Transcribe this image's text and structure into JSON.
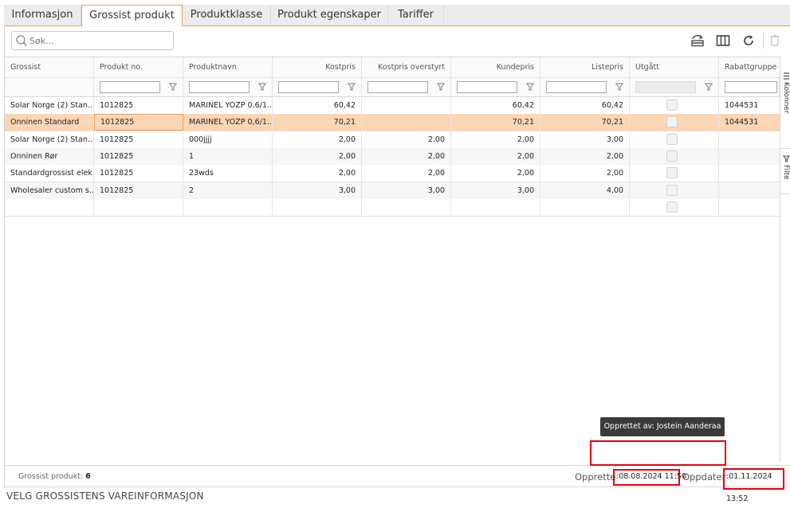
{
  "tabs": [
    {
      "label": "Informasjon",
      "active": false
    },
    {
      "label": "Grossist produkt",
      "active": true
    },
    {
      "label": "Produktklasse",
      "active": false
    },
    {
      "label": "Produkt egenskaper",
      "active": false
    },
    {
      "label": "Tariffer",
      "active": false
    }
  ],
  "search": {
    "placeholder": "Søk..."
  },
  "toolbar": {
    "icons": [
      "wholesaler-fetch-icon",
      "columns-icon",
      "refresh-icon",
      "delete-icon"
    ]
  },
  "grid": {
    "columns": [
      {
        "label": "Grossist"
      },
      {
        "label": "Produkt no."
      },
      {
        "label": "Produktnavn"
      },
      {
        "label": "Kostpris"
      },
      {
        "label": "Kostpris overstyrt"
      },
      {
        "label": "Kundepris"
      },
      {
        "label": "Listepris"
      },
      {
        "label": "Utgått"
      },
      {
        "label": "Rabattgruppe"
      }
    ],
    "rows": [
      {
        "grossist": "Solar Norge (2) Stan...",
        "produkt_no": "1012825",
        "produktnavn": "MARINEL YOZP 0,6/1...",
        "kostpris": "60,42",
        "kostpris_overstyrt": "",
        "kundepris": "60,42",
        "listepris": "60,42",
        "rabattgruppe": "1044531"
      },
      {
        "grossist": "Onninen Standard",
        "produkt_no": "1012825",
        "produktnavn": "MARINEL YOZP 0,6/1...",
        "kostpris": "70,21",
        "kostpris_overstyrt": "",
        "kundepris": "70,21",
        "listepris": "70,21",
        "rabattgruppe": "1044531"
      },
      {
        "grossist": "Solar Norge (2) Stan...",
        "produkt_no": "1012825",
        "produktnavn": "000jjjj",
        "kostpris": "2,00",
        "kostpris_overstyrt": "2,00",
        "kundepris": "2,00",
        "listepris": "3,00",
        "rabattgruppe": ""
      },
      {
        "grossist": "Onninen Rør",
        "produkt_no": "1012825",
        "produktnavn": "1",
        "kostpris": "2,00",
        "kostpris_overstyrt": "2,00",
        "kundepris": "2,00",
        "listepris": "2,00",
        "rabattgruppe": ""
      },
      {
        "grossist": "Standardgrossist elek...",
        "produkt_no": "1012825",
        "produktnavn": "23wds",
        "kostpris": "2,00",
        "kostpris_overstyrt": "2,00",
        "kundepris": "2,00",
        "listepris": "2,00",
        "rabattgruppe": ""
      },
      {
        "grossist": "Wholesaler custom s...",
        "produkt_no": "1012825",
        "produktnavn": "2",
        "kostpris": "3,00",
        "kostpris_overstyrt": "3,00",
        "kundepris": "3,00",
        "listepris": "4,00",
        "rabattgruppe": ""
      },
      {
        "grossist": "",
        "produkt_no": "",
        "produktnavn": "",
        "kostpris": "",
        "kostpris_overstyrt": "",
        "kundepris": "",
        "listepris": "",
        "rabattgruppe": ""
      }
    ]
  },
  "side_panel": {
    "columns_label": "Kolonner",
    "filter_label": "Filte"
  },
  "tooltip": {
    "text": "Opprettet av: Jostein Aanderaa"
  },
  "status": {
    "count_label": "Grossist produkt:",
    "count_value": "6",
    "created_label": "Opprette",
    "created_value": ":08.08.2024 11:50",
    "updated_label": "Oppdater",
    "updated_value": ":01.11.2024 13:52"
  },
  "footer": {
    "title": "VELG GROSSISTENS VAREINFORMASJON"
  },
  "colors": {
    "accent": "#f28c2b",
    "selected_row": "#fcd5b4",
    "annotation": "#e8000b",
    "tooltip_bg": "#3a3a3a"
  }
}
